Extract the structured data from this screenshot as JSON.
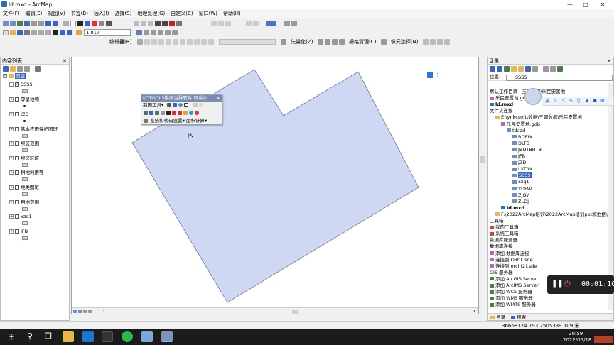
{
  "window": {
    "title": "ld.mxd - ArcMap",
    "min": "—",
    "max": "□",
    "close": "✕"
  },
  "menu": [
    "文件(F)",
    "编辑(E)",
    "视图(V)",
    "书签(B)",
    "插入(I)",
    "选择(S)",
    "地理处理(G)",
    "自定义(C)",
    "窗口(W)",
    "帮助(H)"
  ],
  "toolbar": {
    "scale": "1:817",
    "editor": "编辑器(R)",
    "vectorize": "矢量化(Z)",
    "raster_clean": "栅格清理(C)",
    "cell_select": "像元选择(N)"
  },
  "toc": {
    "title": "内容列表",
    "root": "图层",
    "layers": [
      {
        "name": "SSSS",
        "checked": true,
        "symbol": "swatch",
        "color": "#c9d3ee"
      },
      {
        "name": "零星地物",
        "checked": false,
        "symbol": "dot",
        "color": "#111111"
      },
      {
        "name": "JZD",
        "checked": false,
        "symbol": "dot",
        "color": "#111111"
      },
      {
        "name": "基本农田保护图斑",
        "checked": false,
        "symbol": "swatch",
        "color": "#c3e0bf"
      },
      {
        "name": "坝区范围",
        "checked": false,
        "symbol": "swatch",
        "color": "#d7c7e8"
      },
      {
        "name": "坝区区域",
        "checked": false,
        "symbol": "swatch",
        "color": "#cfe5c8"
      },
      {
        "name": "耕地利用等",
        "checked": false,
        "symbol": "swatch",
        "color": "#bfe6d0"
      },
      {
        "name": "地类图斑",
        "checked": false,
        "symbol": "swatch",
        "color": "#d9e8c4"
      },
      {
        "name": "用地范围",
        "checked": false,
        "symbol": "swatch",
        "color": "#c5d9ef"
      },
      {
        "name": "xzq1",
        "checked": false,
        "symbol": "swatch",
        "color": "#f0e1c8"
      },
      {
        "name": "JFB",
        "checked": false,
        "symbol": "swatch",
        "color": "#d2c9ea"
      }
    ]
  },
  "kctools": {
    "title": "KCTOOLS勘测世界软件,联系Q",
    "draw_tools": "制图工具",
    "systems_code": "系统和代码设置",
    "area_calc": "面积计算"
  },
  "catalog": {
    "title": "目录",
    "location_label": "位置:",
    "location_value": "SSSS",
    "items": [
      {
        "text": "默认工作目录 - 三调数据\\乐民安置地",
        "indent": 0,
        "icon": "none"
      },
      {
        "text": "乐民安置地.gdb",
        "indent": 0,
        "icon": "db"
      },
      {
        "text": "ld.mxd",
        "indent": 0,
        "icon": "mxd",
        "bold": true
      },
      {
        "text": "文件夹连接",
        "indent": 0,
        "icon": "none"
      },
      {
        "text": "E:\\ynkcsoft\\数据\\三调数据\\乐民安置地",
        "indent": 1,
        "icon": "folder"
      },
      {
        "text": "乐民安置地.gdb",
        "indent": 2,
        "icon": "db"
      },
      {
        "text": "tdazd",
        "indent": 3,
        "icon": "ds"
      },
      {
        "text": "BQFW",
        "indent": 4,
        "icon": "fc"
      },
      {
        "text": "DLTB",
        "indent": 4,
        "icon": "fc"
      },
      {
        "text": "JBNTBHTB",
        "indent": 4,
        "icon": "fc"
      },
      {
        "text": "JFB",
        "indent": 4,
        "icon": "fc"
      },
      {
        "text": "JZD",
        "indent": 4,
        "icon": "fc"
      },
      {
        "text": "LXDW",
        "indent": 4,
        "icon": "fc"
      },
      {
        "text": "SSSS",
        "indent": 4,
        "icon": "fc",
        "selected": true
      },
      {
        "text": "xzq1",
        "indent": 4,
        "icon": "fc"
      },
      {
        "text": "YDFW",
        "indent": 4,
        "icon": "fc"
      },
      {
        "text": "ZJQY",
        "indent": 4,
        "icon": "fc"
      },
      {
        "text": "ZLDJ",
        "indent": 4,
        "icon": "fc"
      },
      {
        "text": "ld.mxd",
        "indent": 2,
        "icon": "mxd",
        "bold": true
      },
      {
        "text": "F:\\2022ArcMap培训\\2022ArcMap培训ppt和数据\\",
        "indent": 1,
        "icon": "folder"
      },
      {
        "text": "工具箱",
        "indent": 0,
        "icon": "none"
      },
      {
        "text": "我的工具箱",
        "indent": 0,
        "icon": "tbx"
      },
      {
        "text": "系统工具箱",
        "indent": 0,
        "icon": "tbx"
      },
      {
        "text": "数据库服务器",
        "indent": 0,
        "icon": "none"
      },
      {
        "text": "数据库连接",
        "indent": 0,
        "icon": "none"
      },
      {
        "text": "添加 数据库连接",
        "indent": 0,
        "icon": "db"
      },
      {
        "text": "连接到 ORCL.sde",
        "indent": 0,
        "icon": "db"
      },
      {
        "text": "连接到 orcl (2).sde",
        "indent": 0,
        "icon": "db"
      },
      {
        "text": "GIS 服务器",
        "indent": 0,
        "icon": "none"
      },
      {
        "text": "添加 ArcGIS Server",
        "indent": 0,
        "icon": "srv"
      },
      {
        "text": "添加 ArcIMS Server",
        "indent": 0,
        "icon": "srv"
      },
      {
        "text": "添加 WCS 服务器",
        "indent": 0,
        "icon": "srv"
      },
      {
        "text": "添加 WMS 服务器",
        "indent": 0,
        "icon": "srv"
      },
      {
        "text": "添加 WMTS 服务器",
        "indent": 0,
        "icon": "srv"
      }
    ],
    "tab_catalog": "目录",
    "tab_search": "搜索"
  },
  "overlay_toolbar": {
    "lang": "英"
  },
  "recording": {
    "time": "00:01:16"
  },
  "status": {
    "coords": "36668374.793  2505339.109 米"
  },
  "taskbar": {
    "time": "20:59",
    "date": "2022/05/18"
  },
  "colors": {
    "polygon_fill": "#cfd8f3",
    "polygon_stroke": "#6a7290",
    "selected": "#3366cc"
  }
}
